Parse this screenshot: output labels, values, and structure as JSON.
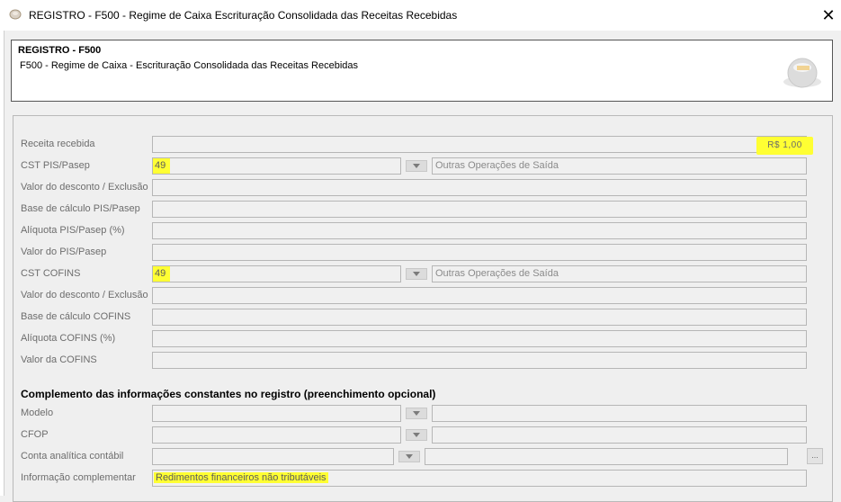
{
  "window": {
    "title": "REGISTRO - F500 - Regime de Caixa  Escrituração Consolidada das Receitas Recebidas",
    "close_glyph": "✕"
  },
  "header": {
    "title": "REGISTRO - F500",
    "subtitle": "F500 - Regime de Caixa - Escrituração Consolidada das Receitas Recebidas"
  },
  "form": {
    "receita": {
      "label": "Receita recebida",
      "value": "R$ 1,00"
    },
    "cst_pis": {
      "label": "CST PIS/Pasep",
      "value": "49",
      "description": "Outras Operações de Saída"
    },
    "desc_pis": {
      "label": "Valor do desconto / Exclusão"
    },
    "base_pis": {
      "label": "Base de cálculo PIS/Pasep"
    },
    "aliq_pis": {
      "label": "Alíquota PIS/Pasep (%)"
    },
    "valor_pis": {
      "label": "Valor do PIS/Pasep"
    },
    "cst_cofins": {
      "label": "CST COFINS",
      "value": "49",
      "description": "Outras Operações de Saída"
    },
    "desc_cofins": {
      "label": "Valor do desconto / Exclusão"
    },
    "base_cofins": {
      "label": "Base de cálculo COFINS"
    },
    "aliq_cofins": {
      "label": "Alíquota COFINS (%)"
    },
    "valor_cofins": {
      "label": "Valor da COFINS"
    }
  },
  "complement": {
    "title": "Complemento das informações constantes no registro (preenchimento opcional)",
    "modelo": {
      "label": "Modelo"
    },
    "cfop": {
      "label": "CFOP"
    },
    "conta": {
      "label": "Conta analítica contábil",
      "button": "..."
    },
    "info": {
      "label": "Informação complementar",
      "value": "Redimentos financeiros não tributáveis"
    }
  },
  "highlight_color": "#ffff33"
}
